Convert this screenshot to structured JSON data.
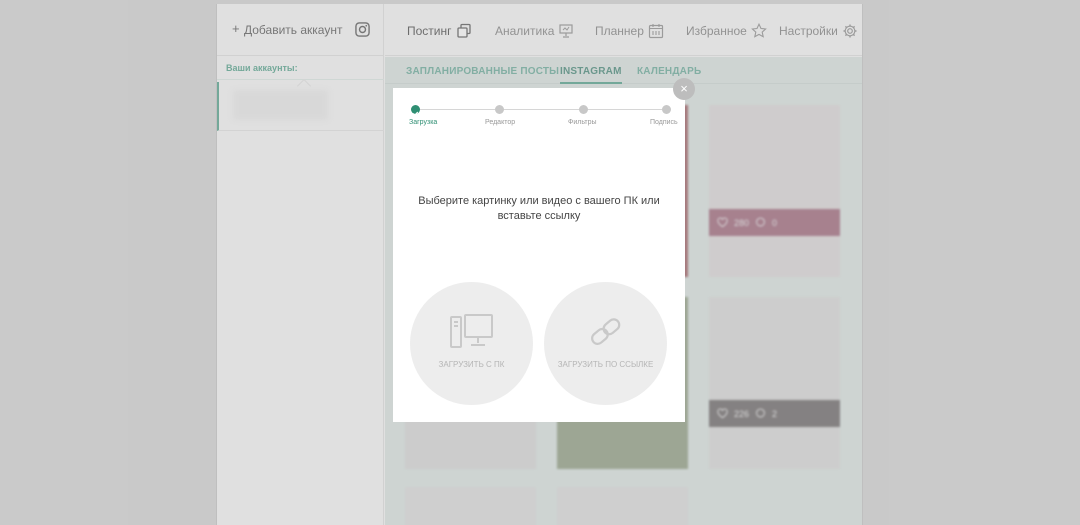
{
  "sidebar": {
    "add_account_label": "Добавить аккаунт",
    "plus": "+",
    "accounts_title": "Ваши аккаунты:"
  },
  "nav": {
    "posting": "Постинг",
    "analytics": "Аналитика",
    "planner": "Планнер",
    "favorites": "Избранное",
    "settings": "Настройки"
  },
  "subtabs": {
    "planned": "ЗАПЛАНИРОВАННЫЕ ПОСТЫ",
    "instagram": "INSTAGRAM",
    "calendar": "КАЛЕНДАРЬ"
  },
  "posts": [
    {
      "likes": "280",
      "comments": "0"
    },
    {
      "likes": "226",
      "comments": "2"
    }
  ],
  "modal": {
    "close": "×",
    "steps": [
      "Загрузка",
      "Редактор",
      "Фильтры",
      "Подпись"
    ],
    "active_step": 0,
    "prompt": "Выберите картинку или видео с вашего ПК или вставьте ссылку",
    "upload_pc": "ЗАГРУЗИТЬ С ПК",
    "upload_link": "ЗАГРУЗИТЬ ПО ССЫЛКЕ"
  },
  "colors": {
    "accent": "#2f8f73",
    "overlay": "#cbcbcb",
    "panel": "#d3dfdb"
  },
  "icons": {
    "instagram": "instagram-icon",
    "posting": "copy-icon",
    "analytics": "presentation-icon",
    "planner": "calendar-icon",
    "favorites": "star-icon",
    "settings": "gear-icon",
    "pc": "desktop-computer-icon",
    "link": "link-icon"
  }
}
